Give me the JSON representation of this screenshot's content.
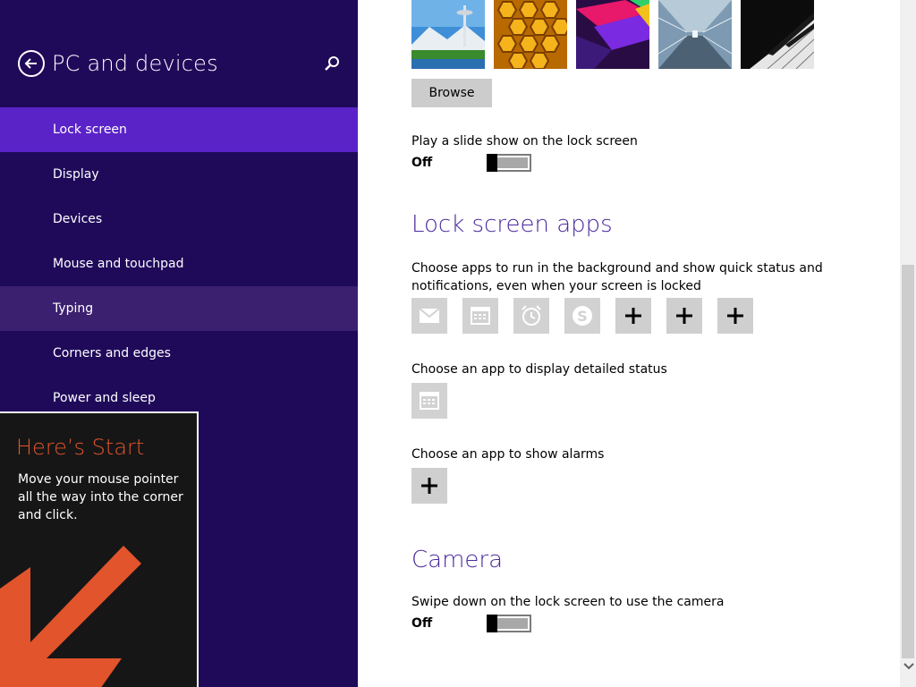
{
  "nav": {
    "title": "PC and devices",
    "items": [
      {
        "label": "Lock screen"
      },
      {
        "label": "Display"
      },
      {
        "label": "Devices"
      },
      {
        "label": "Mouse and touchpad"
      },
      {
        "label": "Typing"
      },
      {
        "label": "Corners and edges"
      },
      {
        "label": "Power and sleep"
      }
    ],
    "selected": "Lock screen"
  },
  "tip": {
    "title": "Here’s Start",
    "text": "Move your mouse pointer all the way into the corner and click."
  },
  "lock_screen": {
    "browse_label": "Browse",
    "slideshow_label": "Play a slide show on the lock screen",
    "slideshow_state": "Off"
  },
  "lock_screen_apps": {
    "heading": "Lock screen apps",
    "description": "Choose apps to run in the background and show quick status and notifications, even when your screen is locked",
    "apps": [
      "mail-icon",
      "calendar-icon",
      "alarm-icon",
      "skype-icon",
      "add-icon",
      "add-icon",
      "add-icon"
    ],
    "detailed_status_label": "Choose an app to display detailed status",
    "detailed_status_app": "calendar-icon",
    "alarms_label": "Choose an app to show alarms",
    "alarms_app": "add-icon"
  },
  "camera": {
    "heading": "Camera",
    "label": "Swipe down on the lock screen to use the camera",
    "state": "Off"
  },
  "colors": {
    "nav_bg": "#1f0a5a",
    "nav_selected": "#5a23c8",
    "accent_heading": "#4b2a9e",
    "tip_title": "#e2542c"
  }
}
